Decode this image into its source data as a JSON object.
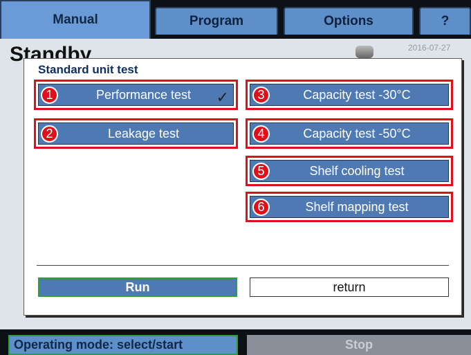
{
  "tabs": [
    {
      "label": "Manual"
    },
    {
      "label": "Program"
    },
    {
      "label": "Options"
    },
    {
      "label": "?"
    }
  ],
  "background": {
    "title": "Standby",
    "date": "2016-07-27"
  },
  "dialog": {
    "title": "Standard unit test",
    "tests": [
      {
        "number": "1",
        "label": "Performance test",
        "checked": true
      },
      {
        "number": "2",
        "label": "Leakage test"
      },
      {
        "number": "3",
        "label": "Capacity test -30°C"
      },
      {
        "number": "4",
        "label": "Capacity test -50°C"
      },
      {
        "number": "5",
        "label": "Shelf cooling test"
      },
      {
        "number": "6",
        "label": "Shelf mapping test"
      }
    ],
    "check_mark": "✓",
    "run_label": "Run",
    "return_label": "return"
  },
  "footer": {
    "mode": "Operating mode: select/start",
    "stop_label": "Stop"
  }
}
